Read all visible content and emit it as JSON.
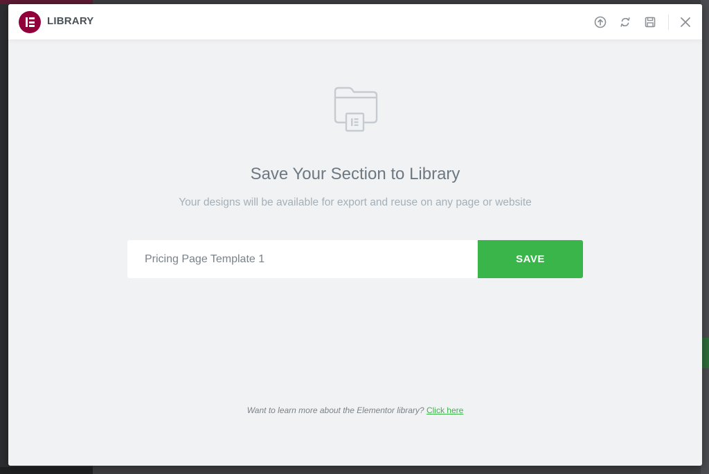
{
  "header": {
    "title": "LIBRARY",
    "tools": [
      {
        "name": "upload-icon"
      },
      {
        "name": "sync-icon"
      },
      {
        "name": "save-icon"
      }
    ],
    "close_icon": "close-icon"
  },
  "main": {
    "illustration_icon": "folder-template-icon",
    "title": "Save Your Section to Library",
    "subtitle": "Your designs will be available for export and reuse on any page or website",
    "input_value": "Pricing Page Template 1",
    "save_label": "SAVE"
  },
  "footer": {
    "note": "Want to learn more about the Elementor library?",
    "link": "Click here"
  },
  "colors": {
    "brand": "#92003b",
    "accent_green": "#39b54a",
    "title_gray": "#6d7882",
    "subtitle_gray": "#a4afb7",
    "modal_bg": "#f1f2f3"
  }
}
